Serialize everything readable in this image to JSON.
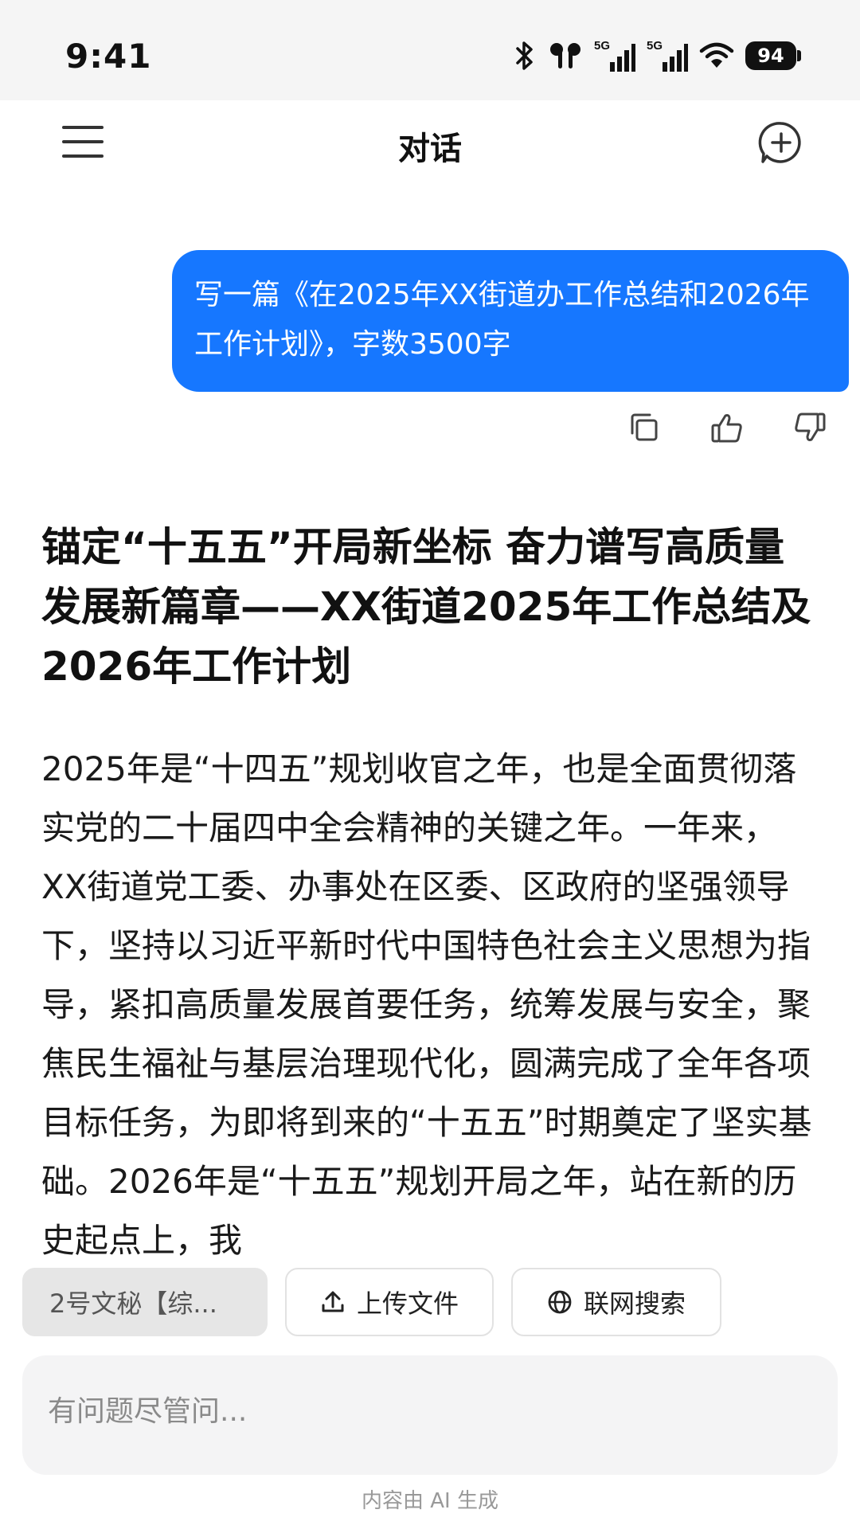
{
  "status_bar": {
    "time": "9:41",
    "network_1": "5G",
    "network_2": "5G",
    "battery": "94",
    "icons": [
      "bluetooth-icon",
      "earbuds-icon",
      "signal-icon",
      "signal-icon",
      "wifi-icon",
      "battery-icon"
    ]
  },
  "header": {
    "title": "对话",
    "menu_icon": "hamburger-menu-icon",
    "new_chat_icon": "new-chat-plus-icon"
  },
  "user_message": {
    "text": "写一篇《在2025年XX街道办工作总结和2026年工作计划》，字数3500字",
    "actions": [
      "copy-icon",
      "thumbs-up-icon",
      "thumbs-down-icon"
    ]
  },
  "answer": {
    "title": "锚定“十五五”开局新坐标 奋力谱写高质量发展新篇章——XX街道2025年工作总结及2026年工作计划",
    "body": "2025年是“十四五”规划收官之年，也是全面贯彻落实党的二十届四中全会精神的关键之年。一年来，XX街道党工委、办事处在区委、区政府的坚强领导下，坚持以习近平新时代中国特色社会主义思想为指导，紧扣高质量发展首要任务，统筹发展与安全，聚焦民生福祉与基层治理现代化，圆满完成了全年各项目标任务，为即将到来的“十五五”时期奠定了坚实基础。2026年是“十五五”规划开局之年，站在新的历史起点上，我"
  },
  "chips": {
    "agent": "2号文秘【综...",
    "upload": "上传文件",
    "search": "联网搜索"
  },
  "input": {
    "placeholder": "有问题尽管问..."
  },
  "footer": {
    "note": "内容由 AI 生成"
  },
  "colors": {
    "accent": "#1677ff",
    "status_bar_bg": "#f5f5f5",
    "input_bg": "#f4f4f5"
  }
}
